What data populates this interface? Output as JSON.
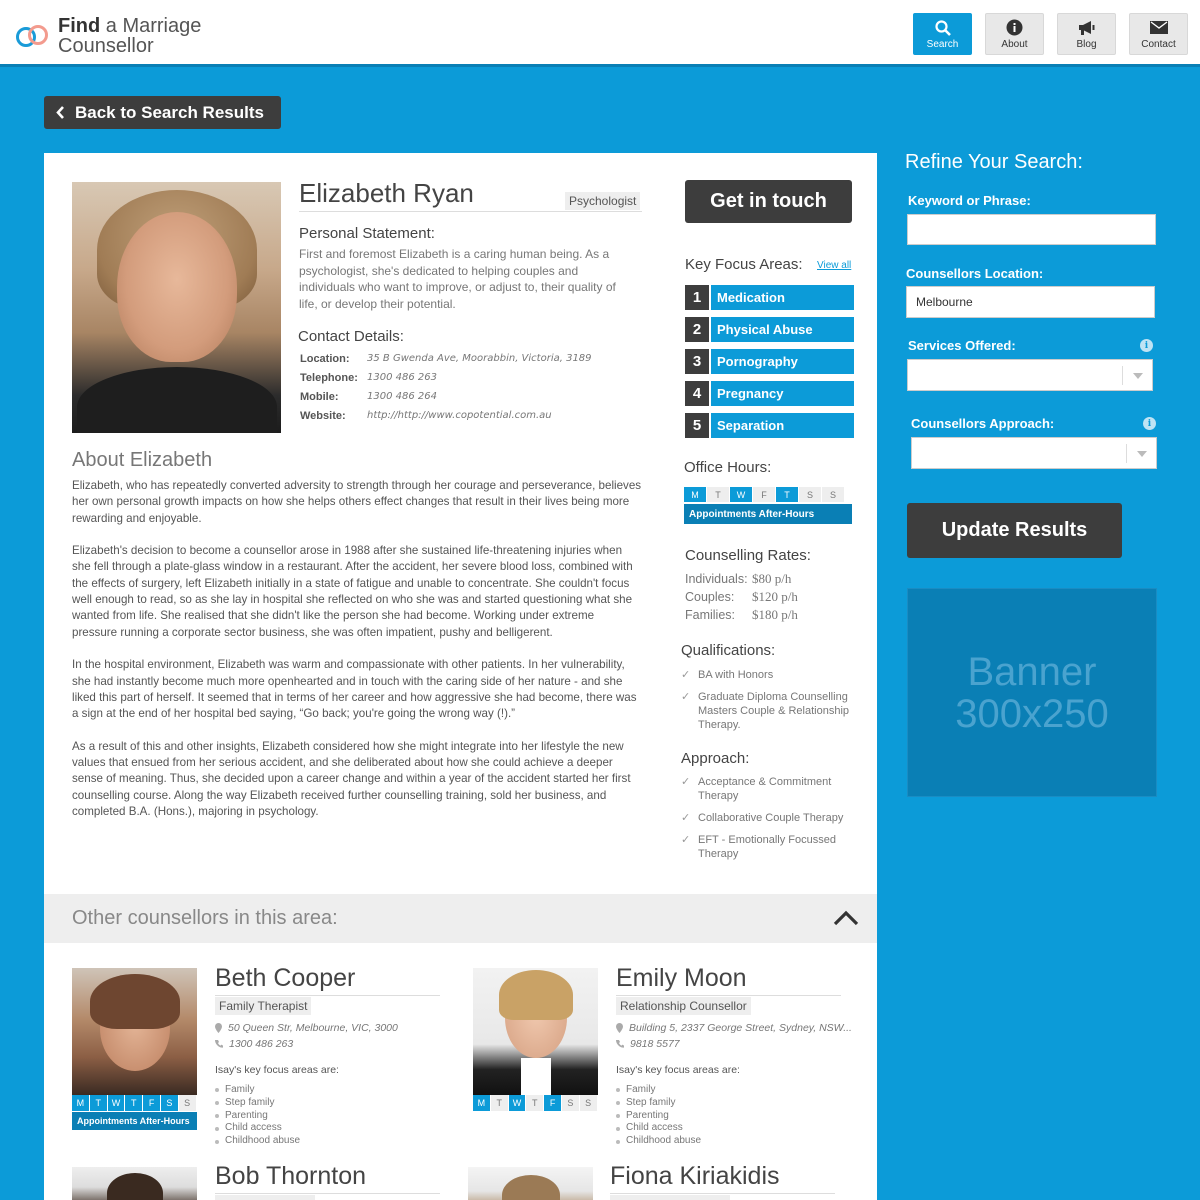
{
  "site": {
    "logo_bold": "Find",
    "logo_rest": " a Marriage",
    "logo_line2": "Counsellor"
  },
  "nav": {
    "search": "Search",
    "about": "About",
    "blog": "Blog",
    "contact": "Contact"
  },
  "back_label": "Back to Search Results",
  "profile": {
    "name": "Elizabeth Ryan",
    "role": "Psychologist",
    "personal_statement_heading": "Personal Statement:",
    "personal_statement": "First and foremost Elizabeth is a caring human being. As a psychologist, she's dedicated to helping couples and individuals who want to improve, or adjust to, their quality of life, or develop their potential.",
    "contact_heading": "Contact Details:",
    "contact": [
      {
        "label": "Location:",
        "value": "35 B Gwenda Ave, Moorabbin, Victoria, 3189"
      },
      {
        "label": "Telephone:",
        "value": "1300 486 263"
      },
      {
        "label": "Mobile:",
        "value": "1300 486 264"
      },
      {
        "label": "Website:",
        "value": "http://http://www.copotential.com.au"
      }
    ],
    "about_heading": "About Elizabeth",
    "about": [
      "Elizabeth, who has repeatedly converted adversity to strength through her courage and perseverance, believes her own personal growth impacts on how she helps others effect changes that result in their lives being more rewarding and enjoyable.",
      "Elizabeth's decision to become a counsellor arose in 1988 after she sustained life-threatening injuries when she fell through a plate-glass window in a restaurant. After the accident, her severe blood loss, combined with the effects of surgery, left Elizabeth initially in a state of fatigue and unable to concentrate. She couldn't focus well enough to read, so as she lay in hospital she reflected on who she was and started questioning what she wanted from life. She realised that she didn't like the person she had become. Working under extreme pressure running a corporate sector business, she was often impatient, pushy and belligerent.",
      "In the hospital environment, Elizabeth was warm and compassionate with other patients. In her vulnerability, she had instantly become much more openhearted and in touch with the caring side of her nature - and she liked this part of herself. It seemed that in terms of her career and how aggressive she had become, there was a sign at the end of her hospital bed saying, “Go back; you're going the wrong way (!).”",
      "As a result of this and other insights, Elizabeth considered how she might integrate into her lifestyle the new values that ensued from her serious accident, and she deliberated about how she could achieve a deeper sense of meaning. Thus, she decided upon a career change and within a year of the accident started her first counselling course. Along the way Elizabeth received further counselling training, sold her business, and completed B.A. (Hons.), majoring in psychology."
    ],
    "get_in_touch": "Get in touch",
    "focus_heading": "Key Focus Areas:",
    "view_all": "View all",
    "focus_areas": [
      {
        "num": "1",
        "label": "Medication"
      },
      {
        "num": "2",
        "label": "Physical Abuse"
      },
      {
        "num": "3",
        "label": "Pornography"
      },
      {
        "num": "4",
        "label": "Pregnancy"
      },
      {
        "num": "5",
        "label": "Separation"
      }
    ],
    "office_heading": "Office Hours:",
    "days": [
      {
        "d": "M",
        "on": true
      },
      {
        "d": "T",
        "on": false
      },
      {
        "d": "W",
        "on": true
      },
      {
        "d": "F",
        "on": false
      },
      {
        "d": "T",
        "on": true
      },
      {
        "d": "S",
        "on": false
      },
      {
        "d": "S",
        "on": false
      }
    ],
    "after_hours": "Appointments After-Hours",
    "rates_heading": "Counselling Rates:",
    "rates": [
      {
        "label": "Individuals:",
        "value": "$80 p/h"
      },
      {
        "label": "Couples:",
        "value": "$120 p/h"
      },
      {
        "label": "Families:",
        "value": "$180 p/h"
      }
    ],
    "qual_heading": "Qualifications:",
    "qualifications": [
      "BA with Honors",
      "Graduate Diploma Counselling Masters Couple & Relationship Therapy."
    ],
    "approach_heading": "Approach:",
    "approaches": [
      "Acceptance & Commitment Therapy",
      "Collaborative Couple Therapy",
      "EFT - Emotionally Focussed Therapy"
    ]
  },
  "other": {
    "heading": "Other counsellors in this area:",
    "counsellors": [
      {
        "name": "Beth Cooper",
        "role": "Family Therapist",
        "address": "50 Queen Str, Melbourne, VIC, 3000",
        "phone": "1300 486 263",
        "focus_heading": "Isay's key focus areas are:",
        "focus": [
          "Family",
          "Step family",
          "Parenting",
          "Child access",
          "Childhood abuse"
        ],
        "days": [
          {
            "d": "M",
            "on": true
          },
          {
            "d": "T",
            "on": true
          },
          {
            "d": "W",
            "on": true
          },
          {
            "d": "T",
            "on": true
          },
          {
            "d": "F",
            "on": true
          },
          {
            "d": "S",
            "on": true
          },
          {
            "d": "S",
            "on": false
          }
        ],
        "after_hours": "Appointments After-Hours"
      },
      {
        "name": "Emily Moon",
        "role": "Relationship Counsellor",
        "address": "Building 5, 2337 George Street, Sydney, NSW...",
        "phone": "9818 5577",
        "focus_heading": "Isay's key focus areas are:",
        "focus": [
          "Family",
          "Step family",
          "Parenting",
          "Child access",
          "Childhood abuse"
        ],
        "days": [
          {
            "d": "M",
            "on": true
          },
          {
            "d": "T",
            "on": false
          },
          {
            "d": "W",
            "on": true
          },
          {
            "d": "T",
            "on": false
          },
          {
            "d": "F",
            "on": true
          },
          {
            "d": "S",
            "on": false
          },
          {
            "d": "S",
            "on": false
          }
        ]
      },
      {
        "name": "Bob Thornton"
      },
      {
        "name": "Fiona Kiriakidis"
      }
    ]
  },
  "sidebar": {
    "title": "Refine Your Search:",
    "keyword_label": "Keyword or Phrase:",
    "keyword_value": "",
    "location_label": "Counsellors Location:",
    "location_value": "Melbourne",
    "services_label": "Services Offered:",
    "approach_label": "Counsellors Approach:",
    "update_label": "Update Results",
    "banner_line1": "Banner",
    "banner_line2": "300x250"
  },
  "colors": {
    "brand_blue": "#0c9bd8",
    "dark": "#3d3d3d",
    "deep_blue": "#0a7fb5"
  }
}
